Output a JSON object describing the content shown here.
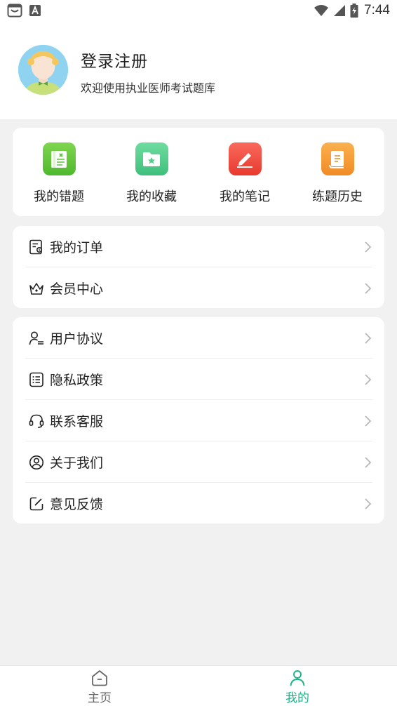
{
  "status_bar": {
    "time": "7:44",
    "left_icons": [
      "notification-face-icon",
      "app-a-icon"
    ],
    "right_icons": [
      "wifi-icon",
      "signal-icon",
      "battery-charging-icon"
    ]
  },
  "profile": {
    "title": "登录注册",
    "subtitle": "欢迎使用执业医师考试题库",
    "avatar": "avatar-illustration"
  },
  "quick_actions": [
    {
      "label": "我的错题",
      "icon": "wrong-questions-icon",
      "color": "#5ec43c"
    },
    {
      "label": "我的收藏",
      "icon": "favorites-folder-icon",
      "color": "#4ecf8a"
    },
    {
      "label": "我的笔记",
      "icon": "notes-pen-icon",
      "color": "#f0463c"
    },
    {
      "label": "练题历史",
      "icon": "history-book-icon",
      "color": "#f59a34"
    }
  ],
  "menu_group_1": [
    {
      "label": "我的订单",
      "icon": "order-icon"
    },
    {
      "label": "会员中心",
      "icon": "crown-icon"
    }
  ],
  "menu_group_2": [
    {
      "label": "用户协议",
      "icon": "user-agreement-icon"
    },
    {
      "label": "隐私政策",
      "icon": "privacy-list-icon"
    },
    {
      "label": "联系客服",
      "icon": "headset-icon"
    },
    {
      "label": "关于我们",
      "icon": "about-user-icon"
    },
    {
      "label": "意见反馈",
      "icon": "feedback-edit-icon"
    }
  ],
  "bottom_nav": {
    "items": [
      {
        "label": "主页",
        "icon": "home-icon",
        "active": false
      },
      {
        "label": "我的",
        "icon": "profile-icon",
        "active": true
      }
    ],
    "active_color": "#1fb38a",
    "inactive_color": "#666666"
  }
}
